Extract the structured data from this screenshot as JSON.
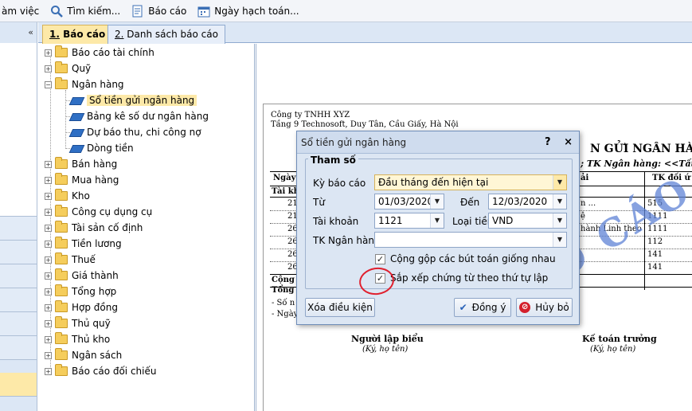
{
  "toolbar": {
    "items": [
      {
        "label": "àm việc",
        "icon": "workspace-icon"
      },
      {
        "label": "Tìm kiếm...",
        "icon": "search-icon"
      },
      {
        "label": "Báo cáo",
        "icon": "report-icon"
      },
      {
        "label": "Ngày hạch toán...",
        "icon": "calendar-icon"
      }
    ]
  },
  "left_panel": {
    "collapse_label": "«"
  },
  "tabs": [
    {
      "num": "1.",
      "label": " Báo cáo"
    },
    {
      "num": "2.",
      "label": " Danh sách báo cáo"
    }
  ],
  "tree": {
    "items": [
      "Báo cáo tài chính",
      "Quỹ",
      "Ngân hàng",
      "Sổ tiền gửi ngân hàng",
      "Bảng kê số dư ngân hàng",
      "Dự báo thu, chi công nợ",
      "Dòng tiền",
      "Bán hàng",
      "Mua hàng",
      "Kho",
      "Công cụ dụng cụ",
      "Tài sản cố định",
      "Tiền lương",
      "Thuế",
      "Giá thành",
      "Tổng hợp",
      "Hợp đồng",
      "Thủ quỹ",
      "Thủ kho",
      "Ngân sách",
      "Báo cáo đối chiếu"
    ]
  },
  "report": {
    "company": "Công ty TNHH XYZ",
    "address": "Tầng 9 Technosoft, Duy Tân, Cầu Giấy, Hà Nội",
    "title": "N GỬI NGÂN HÀN",
    "subtitle": "; TK Ngân hàng: <<Tất c",
    "col_headers": [
      "Ngày",
      "ải",
      "TK đối ứ"
    ],
    "row_label_tk": "Tài khoả",
    "left_cells": [
      "21",
      "21",
      "26",
      "26",
      "26",
      "26"
    ],
    "mid_cells": [
      "n ...",
      "ệ",
      "hành Linh theo",
      "",
      "",
      ""
    ],
    "right_cells": [
      "515",
      "1111",
      "1111",
      "112",
      "141",
      "141"
    ],
    "sum1": "Cộng",
    "sum2": "Tổng c",
    "so_line": "- Số n",
    "ngay_line": "- Ngày",
    "signer1": "Người lập biểu",
    "signer1_note": "(Ký, họ tên)",
    "signer2": "Kế toán trưởng",
    "signer2_note": "(Ký, họ tên)",
    "watermark": "BÁO CÁO M"
  },
  "dialog": {
    "title": "Sổ tiền gửi ngân hàng",
    "help": "?",
    "close": "×",
    "legend": "Tham số",
    "ky_bao_cao_label": "Kỳ báo cáo",
    "ky_bao_cao_value": "Đầu tháng đến hiện tại",
    "tu_label": "Từ",
    "tu_value": "01/03/2020",
    "den_label": "Đến",
    "den_value": "12/03/2020",
    "tai_khoan_label": "Tài khoản",
    "tai_khoan_value": "1121",
    "loai_tien_label": "Loại tiền",
    "loai_tien_value": "VND",
    "tk_ngan_hang_label": "TK Ngân hàng",
    "tk_ngan_hang_value": "",
    "cong_gop_label": "Cộng gộp các bút toán giống nhau",
    "sap_xep_label": "Sắp xếp chứng từ theo thứ tự lập",
    "xoa_label": "Xóa điều kiện",
    "dong_y_label": "Đồng ý",
    "huy_bo_label": "Hủy bỏ"
  }
}
